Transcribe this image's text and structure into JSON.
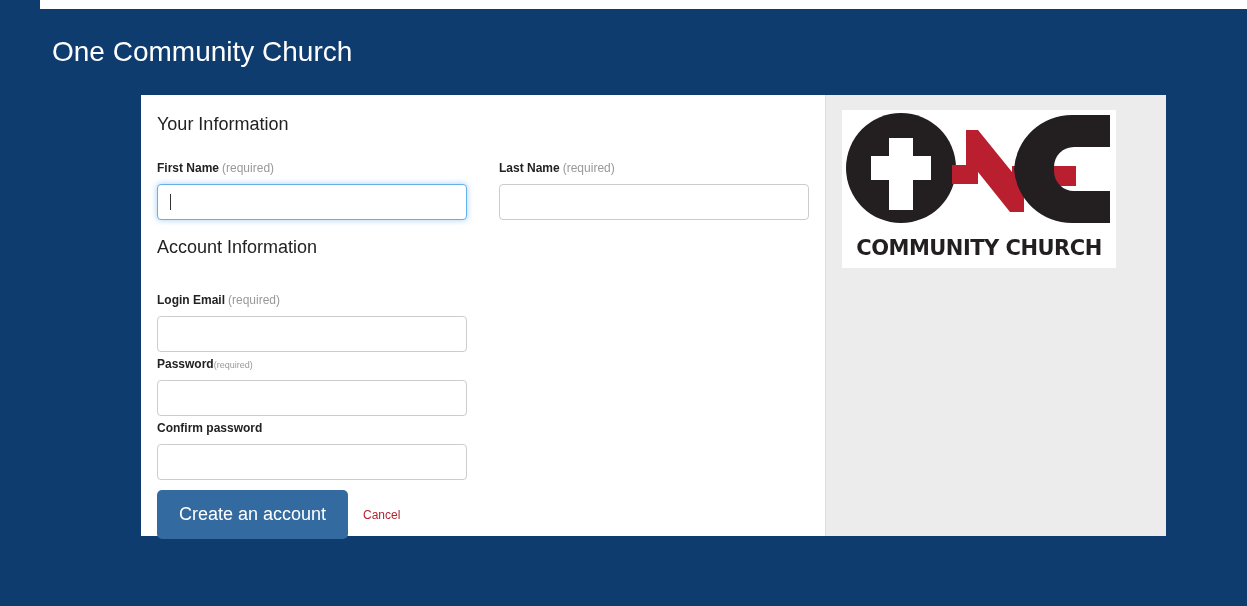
{
  "header": {
    "title": "One Community Church"
  },
  "sections": [
    {
      "title": "Your Information",
      "kind": "pair",
      "fields": [
        {
          "label": "First Name",
          "hint": "(required)",
          "kind": "text",
          "focused": true
        },
        {
          "label": "Last Name",
          "hint": "(required)",
          "kind": "text",
          "focused": false
        }
      ]
    },
    {
      "title": "Account Information",
      "kind": "stack",
      "fields": [
        {
          "label": "Login Email",
          "hint": "(required)",
          "kind": "email",
          "focused": false
        },
        {
          "label": "Password",
          "hint": "(required)",
          "kind": "password",
          "focused": false
        },
        {
          "label": "Confirm password",
          "kind": "password",
          "focused": false
        }
      ]
    }
  ],
  "actions": {
    "submit": "Create an account",
    "cancel": "Cancel"
  },
  "logo": {
    "caption": "COMMUNITY CHURCH"
  }
}
